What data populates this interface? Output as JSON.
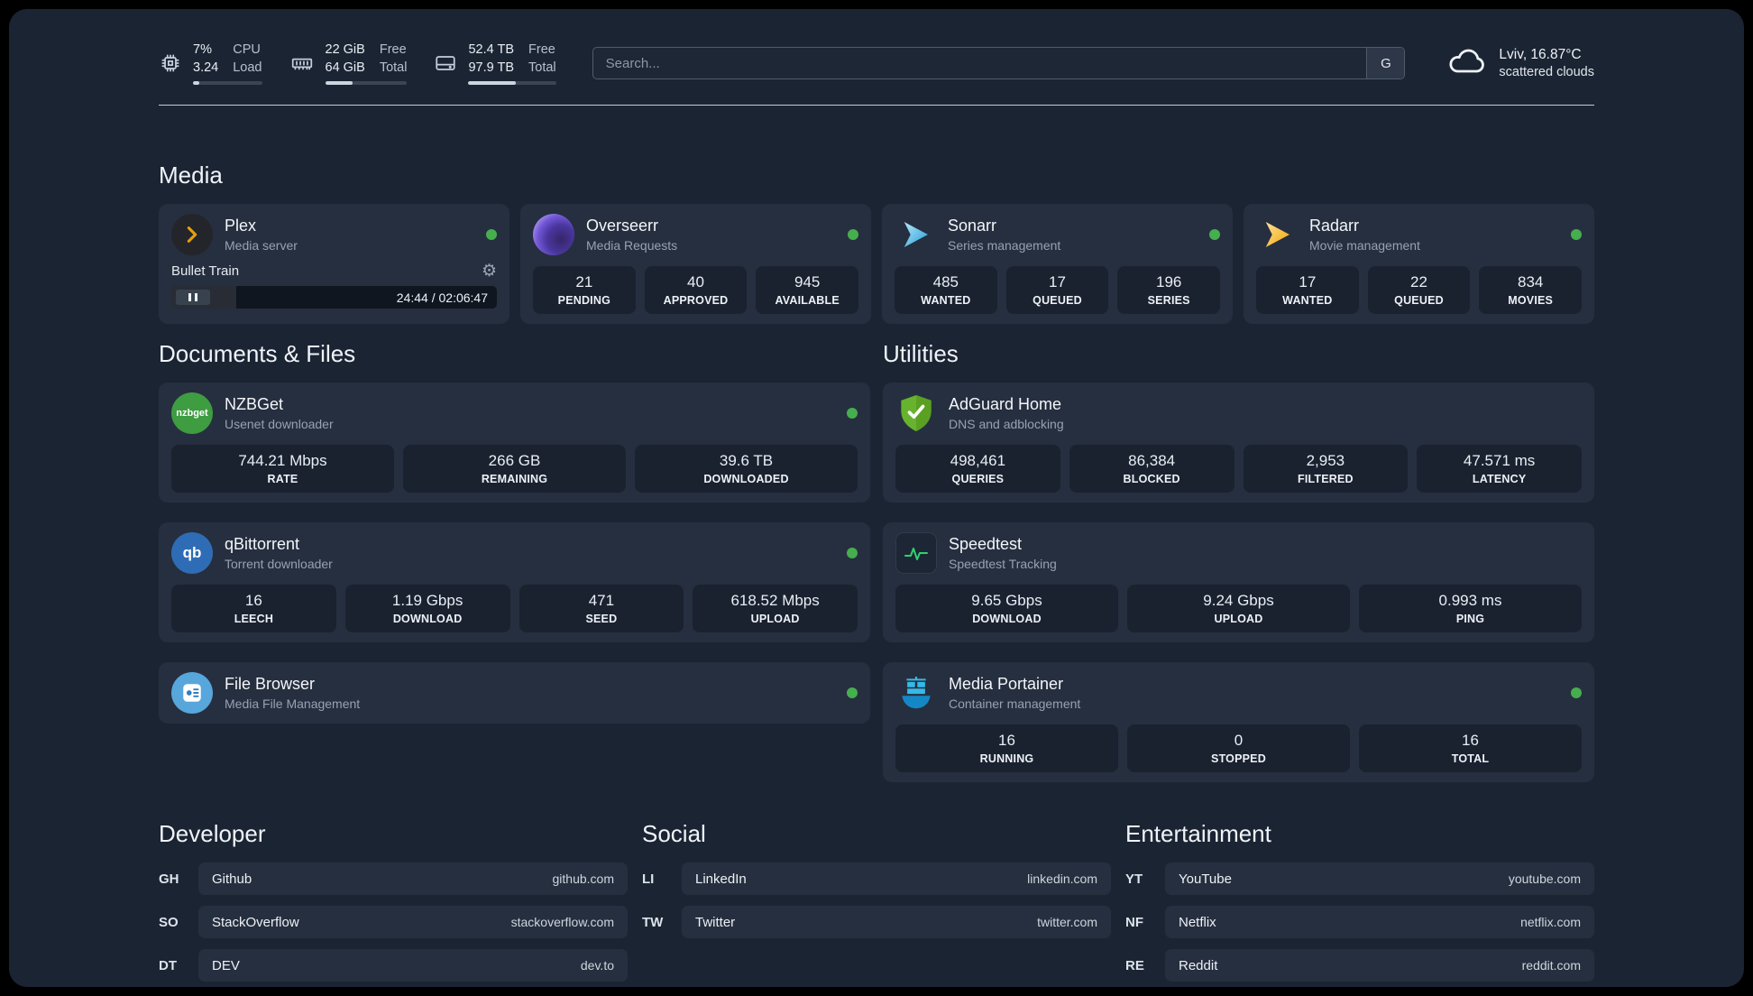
{
  "colors": {
    "page_background": "#1b2433",
    "card_background": "#262f3f",
    "tile_background": "#1a2230",
    "status_online": "#46ae4e",
    "plex_accent": "#e5a00d",
    "overseerr_accent": "#7257d6",
    "sonarr_accent": "#1e9fd8",
    "radarr_accent": "#f0a500",
    "nzbget_accent": "#3e9c41",
    "adguard_accent": "#67b32e",
    "qbittorrent_accent": "#2e6db5",
    "speedtest_accent": "#2dd36f",
    "filebrowser_accent": "#57a6dc",
    "portainer_accent": "#29b6e8"
  },
  "topbar": {
    "system": [
      {
        "name": "cpu",
        "value": "7%",
        "secondary": "3.24",
        "label_top": "CPU",
        "label_bottom": "Load",
        "progress_pct": 9
      },
      {
        "name": "ram",
        "value": "22 GiB",
        "secondary": "64 GiB",
        "label_top": "Free",
        "label_bottom": "Total",
        "progress_pct": 34
      },
      {
        "name": "disk",
        "value": "52.4 TB",
        "secondary": "97.9 TB",
        "label_top": "Free",
        "label_bottom": "Total",
        "progress_pct": 54
      }
    ],
    "search": {
      "placeholder": "Search...",
      "engine_button": "G"
    },
    "weather": {
      "location": "Lviv, 16.87°C",
      "condition": "scattered clouds"
    }
  },
  "media": {
    "title": "Media",
    "apps": {
      "plex": {
        "name": "Plex",
        "subtitle": "Media server",
        "now_playing": "Bullet Train",
        "elapsed_total": "24:44 / 02:06:47",
        "progress_pct": 20
      },
      "overseerr": {
        "name": "Overseerr",
        "subtitle": "Media Requests",
        "stats": [
          {
            "value": "21",
            "label": "PENDING"
          },
          {
            "value": "40",
            "label": "APPROVED"
          },
          {
            "value": "945",
            "label": "AVAILABLE"
          }
        ]
      },
      "sonarr": {
        "name": "Sonarr",
        "subtitle": "Series management",
        "stats": [
          {
            "value": "485",
            "label": "WANTED"
          },
          {
            "value": "17",
            "label": "QUEUED"
          },
          {
            "value": "196",
            "label": "SERIES"
          }
        ]
      },
      "radarr": {
        "name": "Radarr",
        "subtitle": "Movie management",
        "stats": [
          {
            "value": "17",
            "label": "WANTED"
          },
          {
            "value": "22",
            "label": "QUEUED"
          },
          {
            "value": "834",
            "label": "MOVIES"
          }
        ]
      }
    }
  },
  "documents": {
    "title": "Documents & Files",
    "apps": {
      "nzbget": {
        "name": "NZBGet",
        "subtitle": "Usenet downloader",
        "icon_text": "nzbget",
        "stats": [
          {
            "value": "744.21 Mbps",
            "label": "RATE"
          },
          {
            "value": "266 GB",
            "label": "REMAINING"
          },
          {
            "value": "39.6 TB",
            "label": "DOWNLOADED"
          }
        ]
      },
      "qbittorrent": {
        "name": "qBittorrent",
        "subtitle": "Torrent downloader",
        "icon_text": "qb",
        "stats": [
          {
            "value": "16",
            "label": "LEECH"
          },
          {
            "value": "1.19 Gbps",
            "label": "DOWNLOAD"
          },
          {
            "value": "471",
            "label": "SEED"
          },
          {
            "value": "618.52 Mbps",
            "label": "UPLOAD"
          }
        ]
      },
      "filebrowser": {
        "name": "File Browser",
        "subtitle": "Media File Management"
      }
    }
  },
  "utilities": {
    "title": "Utilities",
    "apps": {
      "adguard": {
        "name": "AdGuard Home",
        "subtitle": "DNS and adblocking",
        "stats": [
          {
            "value": "498,461",
            "label": "QUERIES"
          },
          {
            "value": "86,384",
            "label": "BLOCKED"
          },
          {
            "value": "2,953",
            "label": "FILTERED"
          },
          {
            "value": "47.571 ms",
            "label": "LATENCY"
          }
        ]
      },
      "speedtest": {
        "name": "Speedtest",
        "subtitle": "Speedtest Tracking",
        "stats": [
          {
            "value": "9.65 Gbps",
            "label": "DOWNLOAD"
          },
          {
            "value": "9.24 Gbps",
            "label": "UPLOAD"
          },
          {
            "value": "0.993 ms",
            "label": "PING"
          }
        ]
      },
      "portainer": {
        "name": "Media Portainer",
        "subtitle": "Container management",
        "stats": [
          {
            "value": "16",
            "label": "RUNNING"
          },
          {
            "value": "0",
            "label": "STOPPED"
          },
          {
            "value": "16",
            "label": "TOTAL"
          }
        ]
      }
    }
  },
  "links": {
    "developer": {
      "title": "Developer",
      "items": [
        {
          "abbr": "GH",
          "name": "Github",
          "url": "github.com"
        },
        {
          "abbr": "SO",
          "name": "StackOverflow",
          "url": "stackoverflow.com"
        },
        {
          "abbr": "DT",
          "name": "DEV",
          "url": "dev.to"
        }
      ]
    },
    "social": {
      "title": "Social",
      "items": [
        {
          "abbr": "LI",
          "name": "LinkedIn",
          "url": "linkedin.com"
        },
        {
          "abbr": "TW",
          "name": "Twitter",
          "url": "twitter.com"
        }
      ]
    },
    "entertainment": {
      "title": "Entertainment",
      "items": [
        {
          "abbr": "YT",
          "name": "YouTube",
          "url": "youtube.com"
        },
        {
          "abbr": "NF",
          "name": "Netflix",
          "url": "netflix.com"
        },
        {
          "abbr": "RE",
          "name": "Reddit",
          "url": "reddit.com"
        }
      ]
    }
  }
}
